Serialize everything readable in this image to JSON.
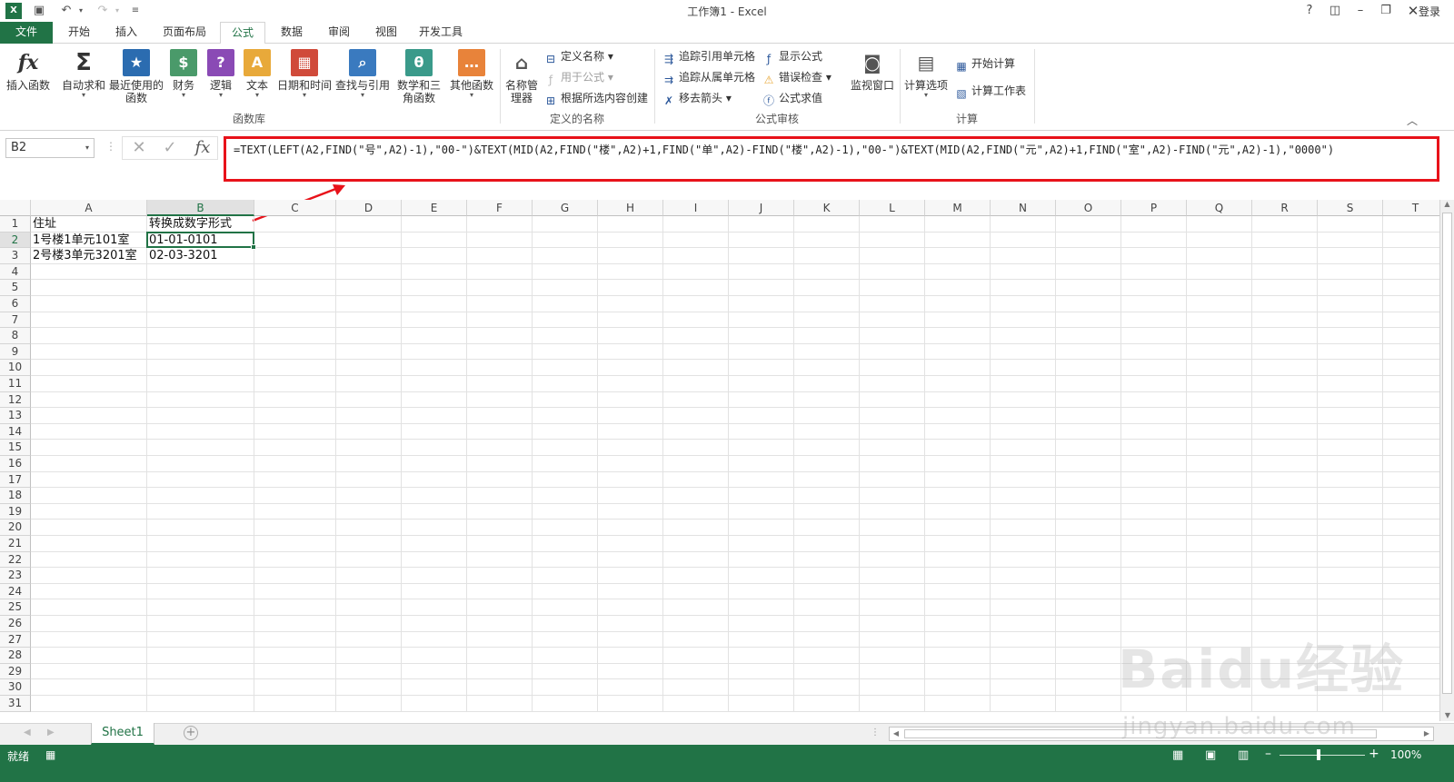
{
  "window": {
    "title": "工作簿1 - Excel",
    "help": "?",
    "login": "登录"
  },
  "tabs": [
    "文件",
    "开始",
    "插入",
    "页面布局",
    "公式",
    "数据",
    "审阅",
    "视图",
    "开发工具"
  ],
  "ribbon": {
    "function_library": {
      "group_label": "函数库",
      "buttons": [
        "插入函数",
        "自动求和",
        "最近使用的函数",
        "财务",
        "逻辑",
        "文本",
        "日期和时间",
        "查找与引用",
        "数学和三角函数",
        "其他函数"
      ]
    },
    "defined_names": {
      "group_label": "定义的名称",
      "name_manager": "名称管理器",
      "define_name": "定义名称",
      "use_in_formula": "用于公式",
      "create_from_selection": "根据所选内容创建"
    },
    "formula_auditing": {
      "group_label": "公式审核",
      "trace_precedents": "追踪引用单元格",
      "trace_dependents": "追踪从属单元格",
      "remove_arrows": "移去箭头",
      "show_formulas": "显示公式",
      "error_checking": "错误检查",
      "evaluate_formula": "公式求值",
      "watch_window": "监视窗口"
    },
    "calculation": {
      "group_label": "计算",
      "calc_options": "计算选项",
      "calc_now": "开始计算",
      "calc_sheet": "计算工作表"
    }
  },
  "formula_bar": {
    "name_box": "B2",
    "fx": "fx",
    "formula": "=TEXT(LEFT(A2,FIND(\"号\",A2)-1),\"00-\")&TEXT(MID(A2,FIND(\"楼\",A2)+1,FIND(\"单\",A2)-FIND(\"楼\",A2)-1),\"00-\")&TEXT(MID(A2,FIND(\"元\",A2)+1,FIND(\"室\",A2)-FIND(\"元\",A2)-1),\"0000\")"
  },
  "sheet": {
    "columns": [
      "A",
      "B",
      "C",
      "D",
      "E",
      "F",
      "G",
      "H",
      "I",
      "J",
      "K",
      "L",
      "M",
      "N",
      "O",
      "P",
      "Q",
      "R",
      "S",
      "T"
    ],
    "rows": [
      "1",
      "2",
      "3",
      "4",
      "5",
      "6",
      "7",
      "8",
      "9",
      "10",
      "11",
      "12",
      "13",
      "14",
      "15",
      "16",
      "17",
      "18",
      "19",
      "20",
      "21",
      "22",
      "23",
      "24",
      "25",
      "26",
      "27",
      "28",
      "29",
      "30",
      "31"
    ],
    "cells": {
      "A1": "住址",
      "B1": "转换成数字形式",
      "A2": "1号楼1单元101室",
      "B2": "01-01-0101",
      "A3": "2号楼3单元3201室",
      "B3": "02-03-3201"
    },
    "selected": "B2"
  },
  "sheet_tabs": [
    "Sheet1"
  ],
  "status": {
    "ready": "就绪",
    "zoom": "100%"
  },
  "watermark": {
    "logo": "Baidu经验",
    "url": "jingyan.baidu.com"
  },
  "colors": {
    "excel_green": "#217346",
    "highlight_red": "#e8121a"
  }
}
